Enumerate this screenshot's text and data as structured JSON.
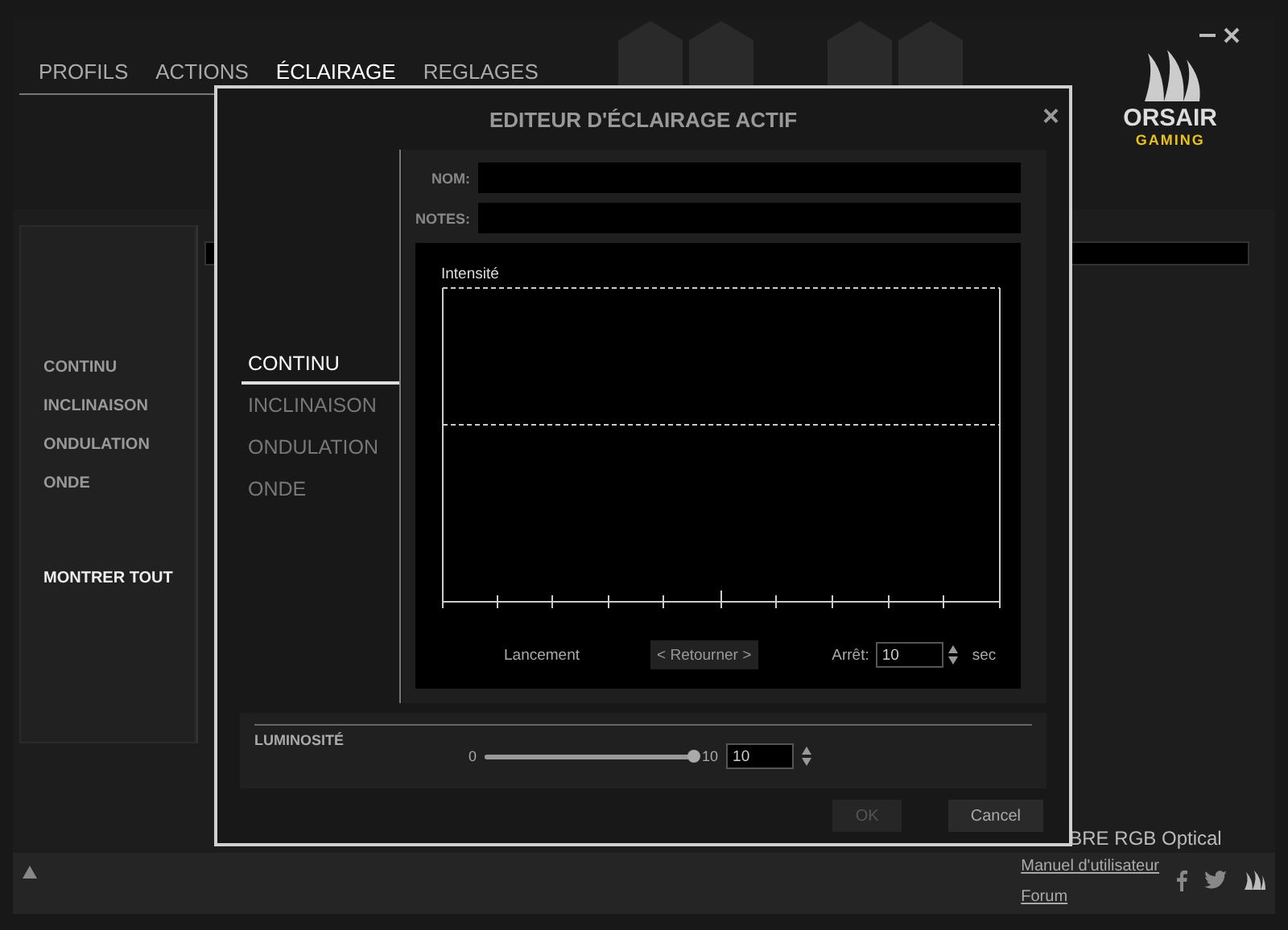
{
  "tabs": [
    {
      "label": "PROFILS",
      "selected": false
    },
    {
      "label": "ACTIONS",
      "selected": false
    },
    {
      "label": "ÉCLAIRAGE",
      "selected": true
    },
    {
      "label": "REGLAGES",
      "selected": false
    }
  ],
  "logo": {
    "wordmark": "ORSAIR",
    "tagline": "GAMING"
  },
  "sidebar": {
    "items": [
      {
        "label": "CONTINU",
        "selected": false
      },
      {
        "label": "INCLINAISON",
        "selected": false
      },
      {
        "label": "ONDULATION",
        "selected": false
      },
      {
        "label": "ONDE",
        "selected": false
      }
    ],
    "show_all": "MONTRER TOUT"
  },
  "footer": {
    "device_name": "BRE RGB Optical",
    "links": [
      "Manuel d'utilisateur",
      "Forum"
    ]
  },
  "dialog": {
    "title": "EDITEUR D'ÉCLAIRAGE ACTIF",
    "close": "×",
    "effects": [
      {
        "label": "CONTINU",
        "selected": true
      },
      {
        "label": "INCLINAISON",
        "selected": false
      },
      {
        "label": "ONDULATION",
        "selected": false
      },
      {
        "label": "ONDE",
        "selected": false
      }
    ],
    "fields": [
      {
        "label": "NOM:"
      },
      {
        "label": "NOTES:"
      }
    ],
    "graph": {
      "ylabel": "Intensité"
    },
    "start_label": "Lancement",
    "reverse_button": "< Retourner >",
    "stop": {
      "label": "Arrêt:",
      "value": "10",
      "unit": "sec"
    },
    "brightness": {
      "label": "LUMINOSITÉ",
      "min": "0",
      "max": "10",
      "value": "10",
      "level": 1
    },
    "buttons": [
      {
        "label": "OK",
        "disabled": true
      },
      {
        "label": "Cancel",
        "disabled": false
      }
    ]
  }
}
